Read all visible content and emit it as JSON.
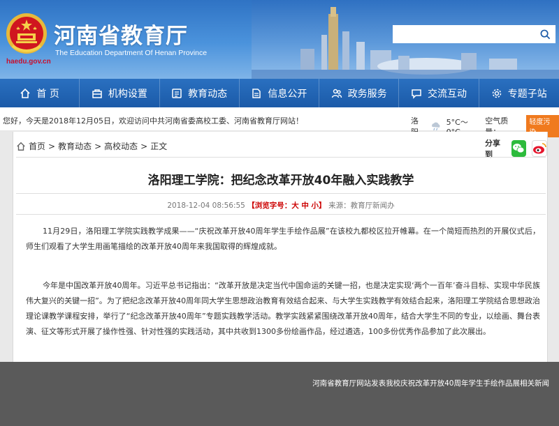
{
  "header": {
    "site_title": "河南省教育厅",
    "site_subtitle": "The Education Department Of Henan Province",
    "site_url": "haedu.gov.cn",
    "search": {
      "placeholder": "",
      "value": ""
    }
  },
  "nav": {
    "items": [
      {
        "label": "首 页",
        "icon": "home-icon"
      },
      {
        "label": "机构设置",
        "icon": "organization-icon"
      },
      {
        "label": "教育动态",
        "icon": "news-icon"
      },
      {
        "label": "信息公开",
        "icon": "document-icon"
      },
      {
        "label": "政务服务",
        "icon": "people-icon"
      },
      {
        "label": "交流互动",
        "icon": "chat-icon"
      },
      {
        "label": "专题子站",
        "icon": "gear-icon"
      }
    ]
  },
  "infobar": {
    "welcome": "您好，今天是2018年12月05日，欢迎访问中共河南省委高校工委、河南省教育厅网站！",
    "city": "洛阳",
    "temperature": "5°C～0°C",
    "aqi_label": "空气质量：",
    "aqi_value": "轻度污染"
  },
  "breadcrumb": {
    "home": "首页",
    "sep1": ">",
    "level1": "教育动态",
    "sep2": ">",
    "level2": "高校动态",
    "sep3": ">",
    "current": "正文"
  },
  "share": {
    "label": "分享到"
  },
  "article": {
    "title": "洛阳理工学院：把纪念改革开放40年融入实践教学",
    "date": "2018-12-04 08:56:55",
    "font_size_label": "【浏览字号：",
    "font_large": "大",
    "font_medium": "中",
    "font_small": "小",
    "font_size_end": "】",
    "source": "来源：教育厅新闻办",
    "paragraphs": [
      "11月29日，洛阳理工学院实践教学成果——“庆祝改革开放40周年学生手绘作品展”在该校九都校区拉开帷幕。在一个简短而热烈的开展仪式后，师生们观看了大学生用画笔描绘的改革开放40周年来我国取得的辉煌成就。",
      "今年是中国改革开放40周年。习近平总书记指出：“改革开放是决定当代中国命运的关键一招，也是决定实现‘两个一百年’奋斗目标、实现中华民族伟大复兴的关键一招”。为了把纪念改革开放40周年同大学生思想政治教育有效结合起来、与大学生实践教学有效结合起来，洛阳理工学院结合思想政治理论课教学课程安排，举行了“纪念改革开放40周年”专题实践教学活动。教学实践紧紧围绕改革开放40周年，结合大学生不同的专业，以绘画、舞台表演、征文等形式开展了操作性强、针对性强的实践活动，其中共收到1300多份绘画作品，经过遴选，100多份优秀作品参加了此次展出。"
    ]
  },
  "footer": {
    "caption": "河南省教育厅网站发表我校庆祝改革开放40周年学生手绘作品展相关新闻"
  },
  "colors": {
    "brand_blue": "#1b5aa8",
    "alert_red": "#c00000",
    "aqi_orange": "#f07a1e"
  }
}
